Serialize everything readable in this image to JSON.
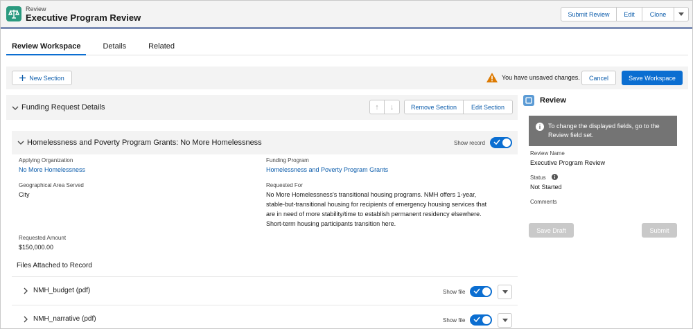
{
  "header": {
    "object_type": "Review",
    "title": "Executive Program Review",
    "buttons": [
      "Submit Review",
      "Edit",
      "Clone"
    ]
  },
  "tabs": [
    {
      "label": "Review Workspace",
      "active": true
    },
    {
      "label": "Details",
      "active": false
    },
    {
      "label": "Related",
      "active": false
    }
  ],
  "toolbar": {
    "new_section": "New Section",
    "warning": "You have unsaved changes.",
    "cancel": "Cancel",
    "save": "Save Workspace"
  },
  "section": {
    "title": "Funding Request Details",
    "remove": "Remove Section",
    "edit": "Edit Section"
  },
  "record": {
    "title": "Homelessness and Poverty Program Grants: No More Homelessness",
    "show_record_label": "Show record",
    "fields": {
      "applying_org_label": "Applying Organization",
      "applying_org_value": "No More Homelessness",
      "funding_program_label": "Funding Program",
      "funding_program_value": "Homelessness and Poverty Program Grants",
      "geo_label": "Geographical Area Served",
      "geo_value": "City",
      "requested_for_label": "Requested For",
      "requested_for_lines": [
        "No More Homelessness's transitional housing programs. NMH offers 1-year,",
        "stable-but-transitional housing for recipients of emergency housing services that",
        "are in need of more stability/time to establish permanent residency elsewhere.",
        "Short-term housing participants transition here."
      ],
      "amount_label": "Requested Amount",
      "amount_value": "$150,000.00"
    }
  },
  "files": {
    "title": "Files Attached to Record",
    "show_file_label": "Show file",
    "items": [
      "NMH_budget (pdf)",
      "NMH_narrative (pdf)"
    ]
  },
  "review_panel": {
    "title": "Review",
    "info": "To change the displayed fields, go to the Review field set.",
    "name_label": "Review Name",
    "name_value": "Executive Program Review",
    "status_label": "Status",
    "status_value": "Not Started",
    "comments_label": "Comments",
    "save_draft": "Save Draft",
    "submit": "Submit"
  },
  "colors": {
    "brand": "#0b6ed1",
    "link": "#0b5cab",
    "warning": "#dd7a01",
    "app_icon": "#2a9a7f"
  }
}
